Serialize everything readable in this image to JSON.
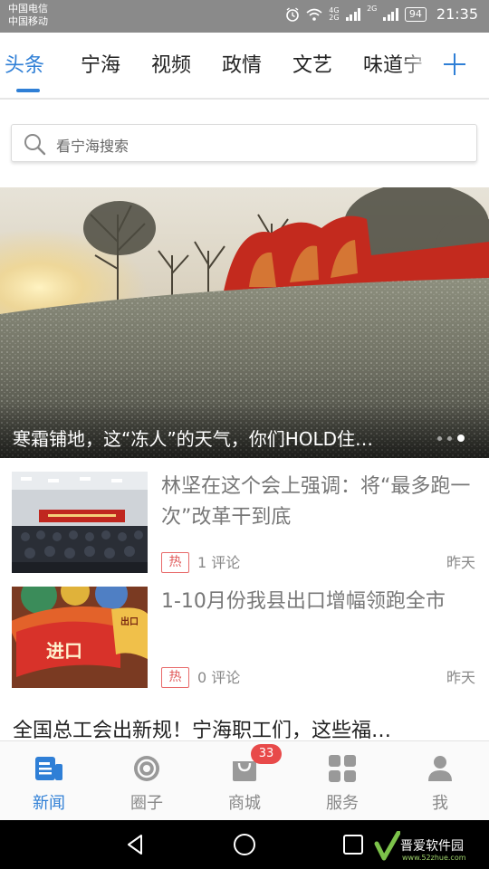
{
  "status_bar": {
    "carrier_1": "中国电信",
    "carrier_2": "中国移动",
    "net_1": "4G",
    "net_2": "2G",
    "net_3": "2G",
    "battery": "94",
    "time": "21:35"
  },
  "channel_tabs": {
    "items": [
      {
        "label": "头条",
        "active": true
      },
      {
        "label": "宁海",
        "active": false
      },
      {
        "label": "视频",
        "active": false
      },
      {
        "label": "政情",
        "active": false
      },
      {
        "label": "文艺",
        "active": false
      },
      {
        "label": "味道宁",
        "active": false
      }
    ],
    "add_icon": "plus-icon"
  },
  "search": {
    "placeholder": "看宁海搜索"
  },
  "banner": {
    "caption": "寒霜铺地，这“冻人”的天气，你们HOLD住…",
    "dots_total": 3,
    "dots_active": 3
  },
  "news": [
    {
      "title": "林坚在这个会上强调：将“最多跑一次”改革干到底",
      "tag": "热",
      "comments": "1 评论",
      "time": "昨天"
    },
    {
      "title": "1-10月份我县出口增幅领跑全市",
      "tag": "热",
      "comments": "0 评论",
      "time": "昨天",
      "image_text_1": "进口",
      "image_text_2": "出口"
    }
  ],
  "news_text_only": {
    "title": "全国总工会出新规！宁海职工们，这些福…"
  },
  "bottom_nav": {
    "items": [
      {
        "label": "新闻",
        "icon": "news-icon",
        "active": true
      },
      {
        "label": "圈子",
        "icon": "circle-icon",
        "active": false
      },
      {
        "label": "商城",
        "icon": "shopping-bag-icon",
        "active": false,
        "badge": "33"
      },
      {
        "label": "服务",
        "icon": "grid-icon",
        "active": false
      },
      {
        "label": "我",
        "icon": "user-icon",
        "active": false
      }
    ]
  },
  "system_bar": {
    "buttons": [
      "back-icon",
      "home-icon",
      "recents-icon"
    ]
  },
  "watermark": {
    "text": "晋爱软件园",
    "url": "www.52zhue.com"
  },
  "colors": {
    "accent": "#2f7fd6",
    "hot": "#e05a5a",
    "badge": "#e84a4a",
    "status_bar": "#8a8a8a"
  }
}
